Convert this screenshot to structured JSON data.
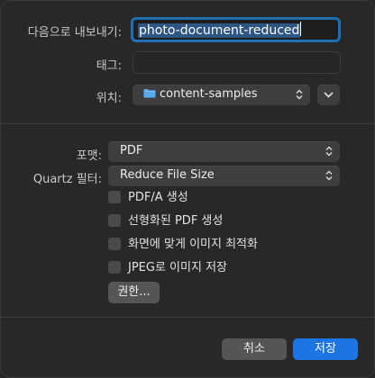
{
  "save_as": {
    "label": "다음으로 내보내기:",
    "value_selected": "photo-document-reduced"
  },
  "tags": {
    "label": "태그:",
    "value": ""
  },
  "location": {
    "label": "위치:",
    "value": "content-samples",
    "folder_color": "#5aa9ee"
  },
  "format": {
    "label": "포맷:",
    "value": "PDF"
  },
  "quartz_filter": {
    "label": "Quartz 필터:",
    "value": "Reduce File Size"
  },
  "options": [
    {
      "label": "PDF/A 생성",
      "checked": false
    },
    {
      "label": "선형화된 PDF 생성",
      "checked": false
    },
    {
      "label": "화면에 맞게 이미지 최적화",
      "checked": false
    },
    {
      "label": "JPEG로 이미지 저장",
      "checked": false
    }
  ],
  "permissions_button": "권한...",
  "cancel_button": "취소",
  "save_button": "저장",
  "colors": {
    "accent": "#1d74e4",
    "focus_ring": "#1f6fb5"
  }
}
